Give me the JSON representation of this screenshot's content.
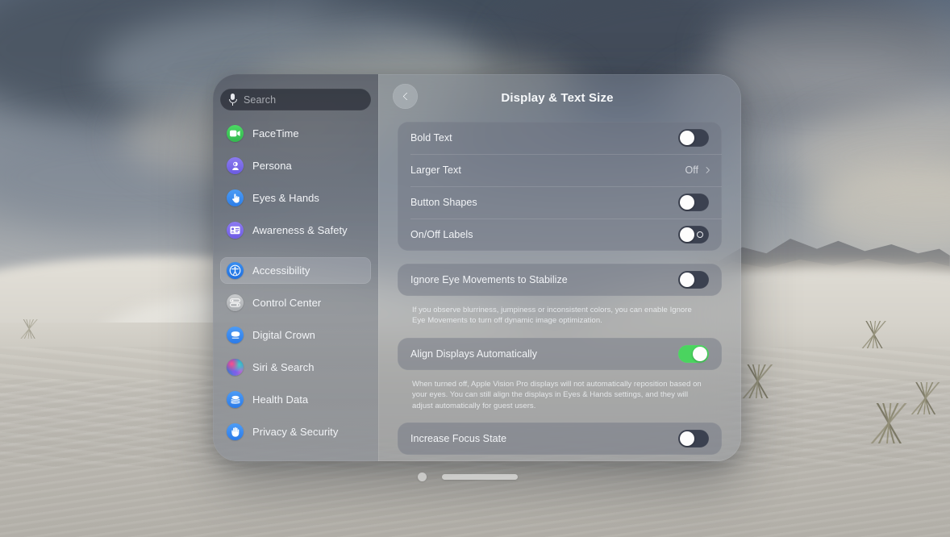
{
  "window": {
    "search": {
      "placeholder": "Search",
      "icon": "microphone-icon"
    },
    "sidebar": {
      "items": [
        {
          "label": "FaceTime",
          "icon": "facetime-video-icon",
          "selected": false
        },
        {
          "label": "Persona",
          "icon": "persona-icon",
          "selected": false
        },
        {
          "label": "Eyes & Hands",
          "icon": "hand-pointer-icon",
          "selected": false
        },
        {
          "label": "Awareness & Safety",
          "icon": "awareness-safety-icon",
          "selected": false
        },
        {
          "label": "Accessibility",
          "icon": "accessibility-icon",
          "selected": true
        },
        {
          "label": "Control Center",
          "icon": "control-center-icon",
          "selected": false
        },
        {
          "label": "Digital Crown",
          "icon": "digital-crown-icon",
          "selected": false
        },
        {
          "label": "Siri & Search",
          "icon": "siri-orb-icon",
          "selected": false
        },
        {
          "label": "Health Data",
          "icon": "health-data-icon",
          "selected": false
        },
        {
          "label": "Privacy & Security",
          "icon": "privacy-hand-icon",
          "selected": false
        }
      ]
    },
    "detail": {
      "title": "Display & Text Size",
      "back_icon": "chevron-left-icon",
      "group1": [
        {
          "label": "Bold Text",
          "control": "toggle",
          "state": "off"
        },
        {
          "label": "Larger Text",
          "control": "disclosure",
          "value": "Off"
        },
        {
          "label": "Button Shapes",
          "control": "toggle",
          "state": "off"
        },
        {
          "label": "On/Off Labels",
          "control": "toggle",
          "state": "off",
          "off_mark": true
        }
      ],
      "group2": {
        "row": {
          "label": "Ignore Eye Movements to Stabilize",
          "control": "toggle",
          "state": "off"
        },
        "note": "If you observe blurriness, jumpiness or inconsistent colors, you can enable Ignore Eye Movements to turn off dynamic image optimization."
      },
      "group3": {
        "row": {
          "label": "Align Displays Automatically",
          "control": "toggle",
          "state": "on"
        },
        "note": "When turned off, Apple Vision Pro displays will not automatically reposition based on your eyes. You can still align the displays in Eyes & Hands settings, and they will adjust automatically for guest users."
      },
      "group4": {
        "row": {
          "label": "Increase Focus State",
          "control": "toggle",
          "state": "off"
        }
      }
    },
    "chrome": {
      "close_icon": "close-dot-icon",
      "resize_handle": "window-resize-bar"
    }
  },
  "colors": {
    "toggle_on": "#4ad45f",
    "toggle_off": "#3b4150",
    "accent_blue": "#2b7be9"
  }
}
